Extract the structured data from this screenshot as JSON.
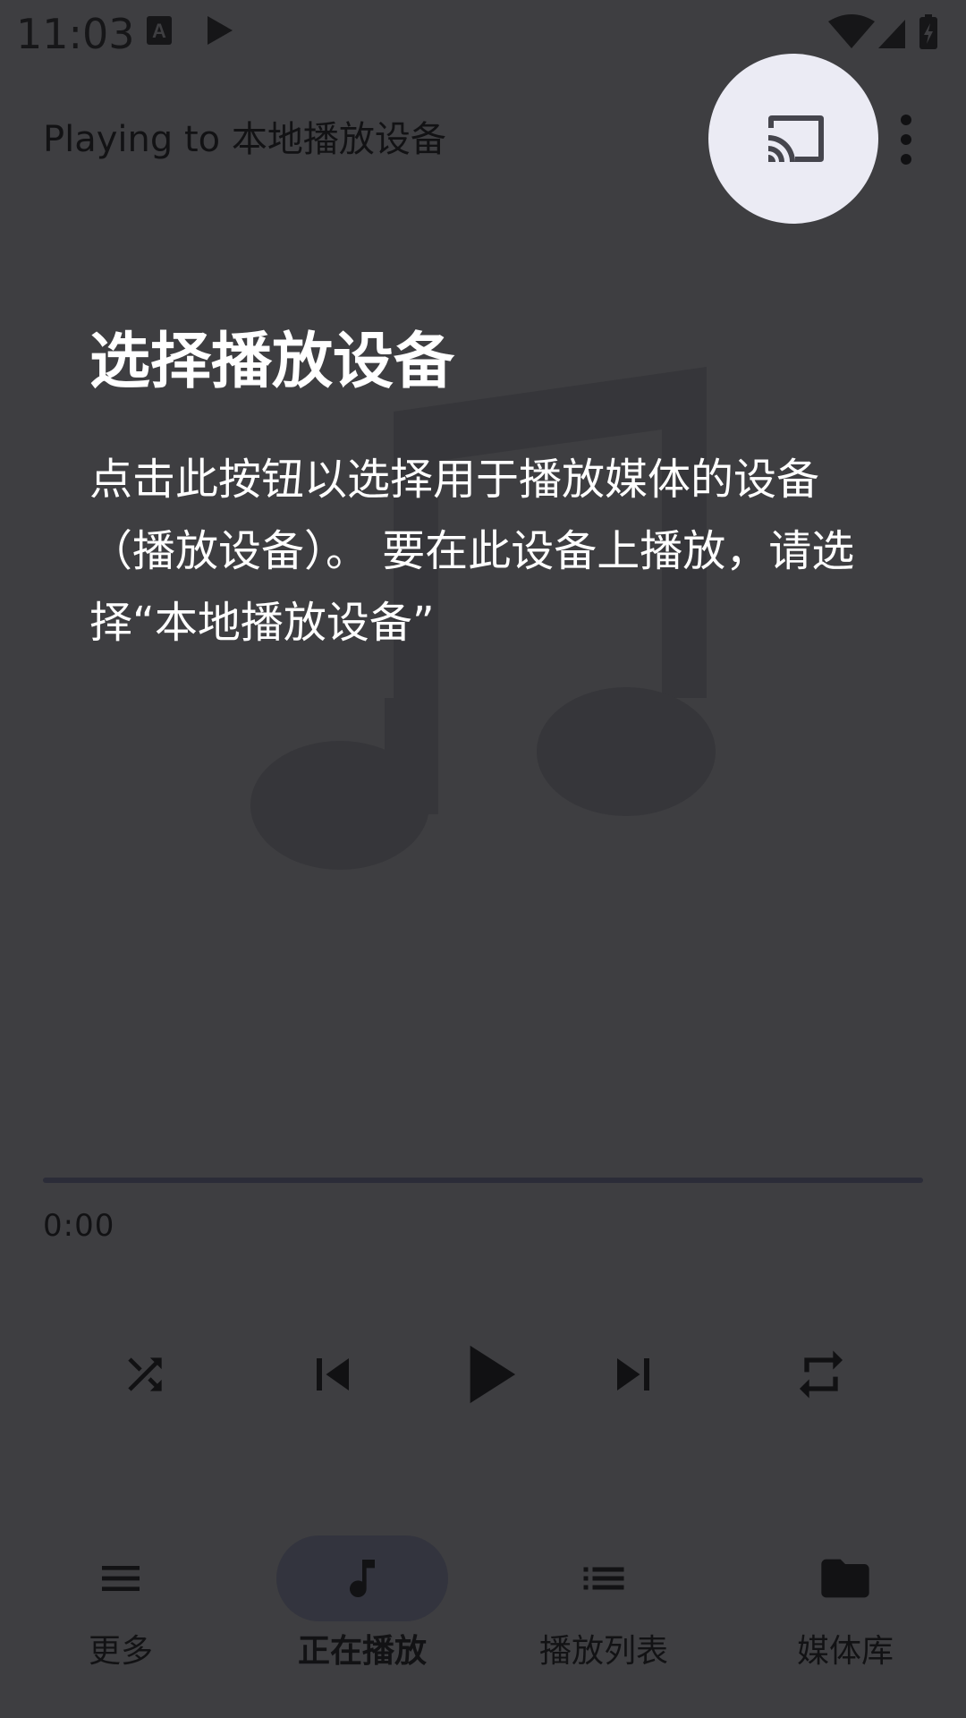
{
  "status_bar": {
    "time": "11:03",
    "icons_left": [
      "keyboard-a-icon",
      "play-notification-icon"
    ],
    "icons_right": [
      "wifi-icon",
      "signal-icon",
      "battery-charging-icon"
    ]
  },
  "app_bar": {
    "title": "Playing to 本地播放设备",
    "actions": [
      "cast-icon",
      "more-vert-icon"
    ]
  },
  "hint": {
    "title": "选择播放设备",
    "description": "点击此按钮以选择用于播放媒体的设备（播放设备）。 要在此设备上播放，请选择“本地播放设备”"
  },
  "player": {
    "elapsed": "0:00",
    "progress": 0,
    "controls": [
      "shuffle-icon",
      "skip-previous-icon",
      "play-icon",
      "skip-next-icon",
      "repeat-icon"
    ]
  },
  "bottom_nav": {
    "items": [
      {
        "label": "更多",
        "icon": "menu-icon",
        "active": false
      },
      {
        "label": "正在播放",
        "icon": "music-note-icon",
        "active": true
      },
      {
        "label": "播放列表",
        "icon": "list-icon",
        "active": false
      },
      {
        "label": "媒体库",
        "icon": "folder-icon",
        "active": false
      }
    ]
  },
  "colors": {
    "scrim": "#3e3e41",
    "highlight": "#ebebf4",
    "active_pill": "#33343e",
    "text_on_scrim": "#ffffff",
    "dim_text": "#121214"
  }
}
